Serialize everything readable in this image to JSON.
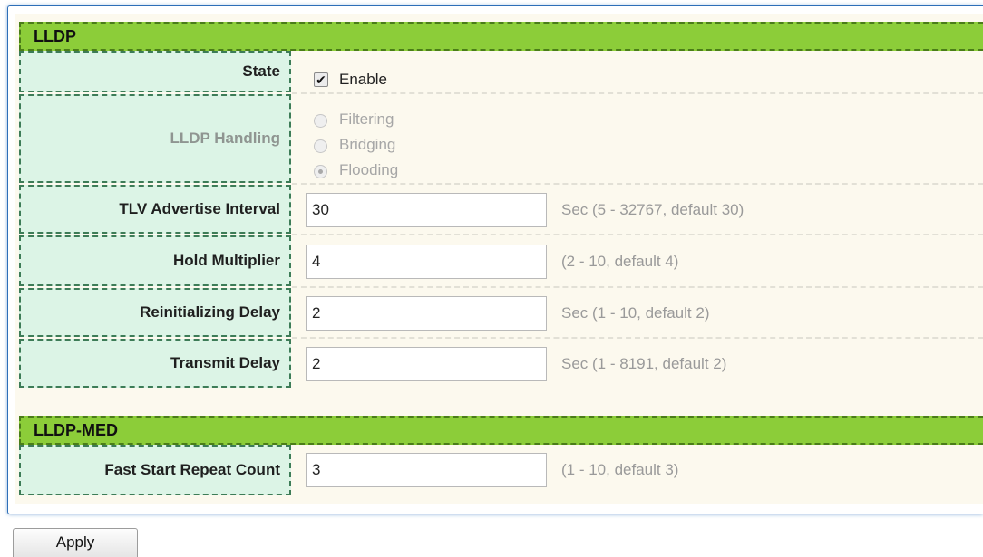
{
  "lldp": {
    "header": "LLDP",
    "state": {
      "label": "State",
      "enabled": true,
      "option_label": "Enable"
    },
    "handling": {
      "label": "LLDP Handling",
      "options": [
        "Filtering",
        "Bridging",
        "Flooding"
      ],
      "selected": "Flooding"
    },
    "tlv_interval": {
      "label": "TLV Advertise Interval",
      "value": "30",
      "hint": "Sec (5 - 32767, default 30)"
    },
    "hold_multiplier": {
      "label": "Hold Multiplier",
      "value": "4",
      "hint": "(2 - 10, default 4)"
    },
    "reinit_delay": {
      "label": "Reinitializing Delay",
      "value": "2",
      "hint": "Sec (1 - 10, default 2)"
    },
    "transmit_delay": {
      "label": "Transmit Delay",
      "value": "2",
      "hint": "Sec (1 - 8191, default 2)"
    }
  },
  "lldp_med": {
    "header": "LLDP-MED",
    "fast_start": {
      "label": "Fast Start Repeat Count",
      "value": "3",
      "hint": "(1 - 10, default 3)"
    }
  },
  "apply_label": "Apply",
  "colors": {
    "header_green": "#8ccd39",
    "label_bg": "#dcf4e6",
    "panel_bg": "#fcf9ee",
    "panel_border": "#2e6fb8"
  }
}
